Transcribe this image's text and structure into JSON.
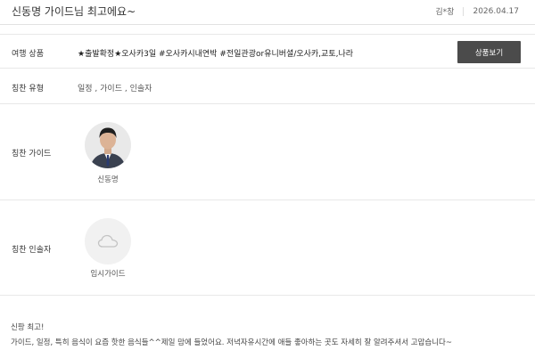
{
  "review": {
    "title": "신동명 가이드님 최고에요~",
    "author": "김*창",
    "date": "2026.04.17",
    "product": {
      "label": "여행 상품",
      "name": "★출발확정★오사카3일 #오사카시내연박 #전일관광or유니버셜/오사카,교토,나라",
      "button": "상품보기"
    },
    "praise_type": {
      "label": "칭찬 유형",
      "value": "일정 , 가이드 , 인솔자"
    },
    "praise_guide": {
      "label": "칭찬 가이드",
      "name": "신동명"
    },
    "praise_leader": {
      "label": "칭찬 인솔자",
      "name": "임시가이드"
    },
    "body": {
      "line1": "신팡 최고!",
      "line2": "가이드, 일정, 특히 음식이 요즘 핫한 음식들^^제일 맘에 들었어요. 저녁자유시간에 애들 좋아하는 곳도 자세히 잘 알려주셔서 고맙습니다~"
    }
  }
}
